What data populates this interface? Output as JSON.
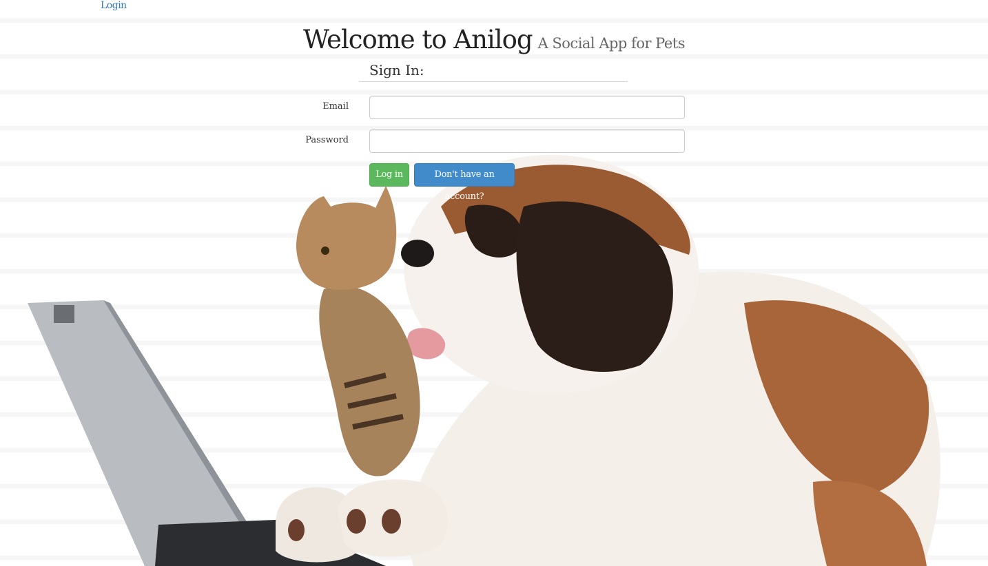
{
  "nav": {
    "login_link": "Login"
  },
  "header": {
    "title": "Welcome to Anilog",
    "subtitle": "A Social App for Pets"
  },
  "form": {
    "legend": "Sign In:",
    "email_label": "Email",
    "email_value": "",
    "password_label": "Password",
    "password_value": "",
    "login_button": "Log in",
    "signup_button": "Don't have an account?"
  },
  "colors": {
    "link": "#337ab7",
    "success": "#5cb85c",
    "primary": "#428bca"
  },
  "icons": {
    "hero": "dog-and-cat-with-laptop-illustration"
  }
}
